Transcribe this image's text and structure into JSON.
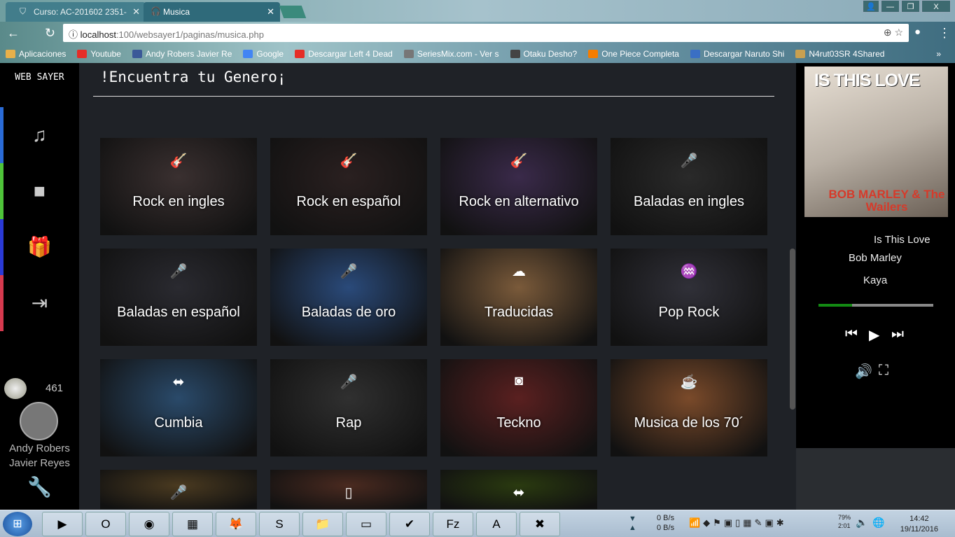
{
  "browser": {
    "tabs": [
      {
        "label": "Curso: AC-201602 2351-",
        "icon": "moodle-icon"
      },
      {
        "label": "Musica",
        "icon": "headphones-icon"
      }
    ],
    "url_host": "localhost",
    "url_path": ":100/websayer1/paginas/musica.php",
    "bookmarks": [
      "Aplicaciones",
      "Youtube",
      "Andy Robers Javier Re",
      "Google",
      "Descargar Left 4 Dead",
      "SeriesMix.com - Ver s",
      "Otaku Desho?",
      "One Piece Completa",
      "Descargar Naruto Shi",
      "N4rut03SR 4Shared"
    ],
    "bookmark_colors": [
      "#e8b04a",
      "#e52d27",
      "#3b5998",
      "#4285f4",
      "#e52d27",
      "#777",
      "#444",
      "#f57d00",
      "#3a6fc4",
      "#c8a050"
    ],
    "more": "»"
  },
  "sidebar": {
    "logo": "WEB SAYER",
    "items": [
      {
        "icon": "music-icon",
        "glyph": "♫",
        "color": "#2a6bd6"
      },
      {
        "icon": "folder-icon",
        "glyph": "■",
        "color": "#4fc43a"
      },
      {
        "icon": "gift-icon",
        "glyph": "🎁",
        "color": "#2a3ad6"
      },
      {
        "icon": "sign-in-icon",
        "glyph": "⇥",
        "color": "#d63a4f"
      }
    ],
    "coins": "461",
    "user_name": "Andy Robers",
    "user_surname": "Javier Reyes"
  },
  "main": {
    "title": "!Encuentra tu Genero¡",
    "genres": [
      {
        "label": "Rock en ingles",
        "glyph": "🎸",
        "bg": "#3a3030"
      },
      {
        "label": "Rock en español",
        "glyph": "🎸",
        "bg": "#2a2020"
      },
      {
        "label": "Rock en alternativo",
        "glyph": "🎸",
        "bg": "#3a2a4a"
      },
      {
        "label": "Baladas en ingles",
        "glyph": "🎤",
        "bg": "#2a2a2a"
      },
      {
        "label": "Baladas en español",
        "glyph": "🎤",
        "bg": "#2a2a30"
      },
      {
        "label": "Baladas de oro",
        "glyph": "🎤",
        "bg": "#2a4a7a"
      },
      {
        "label": "Traducidas",
        "glyph": "☁",
        "bg": "#7a5a3a"
      },
      {
        "label": "Pop Rock",
        "glyph": "♒",
        "bg": "#303038"
      },
      {
        "label": "Cumbia",
        "glyph": "⬌",
        "bg": "#2a4a6a"
      },
      {
        "label": "Rap",
        "glyph": "🎤",
        "bg": "#303030"
      },
      {
        "label": "Teckno",
        "glyph": "◙",
        "bg": "#5a2020"
      },
      {
        "label": "Musica de los 70´",
        "glyph": "☕",
        "bg": "#7a4a2a"
      },
      {
        "label": "",
        "glyph": "🎤",
        "bg": "#4a3a20"
      },
      {
        "label": "",
        "glyph": "▯",
        "bg": "#4a2a20"
      },
      {
        "label": "",
        "glyph": "⬌",
        "bg": "#2a3a10"
      }
    ]
  },
  "player": {
    "cover_title": "IS THIS LOVE",
    "cover_artist": "BOB MARLEY & The Wailers",
    "song": "Is This Love",
    "artist": "Bob Marley",
    "album": "Kaya",
    "progress": 0.29
  },
  "taskbar": {
    "apps": [
      "▶",
      "O",
      "◉",
      "▦",
      "🦊",
      "S",
      "📁",
      "▭",
      "✔",
      "Fz",
      "A",
      "✖"
    ],
    "net_down": "0 B/s",
    "net_up": "0 B/s",
    "battery": "79%",
    "battery_time": "2:01",
    "time": "14:42",
    "date": "19/11/2016"
  }
}
